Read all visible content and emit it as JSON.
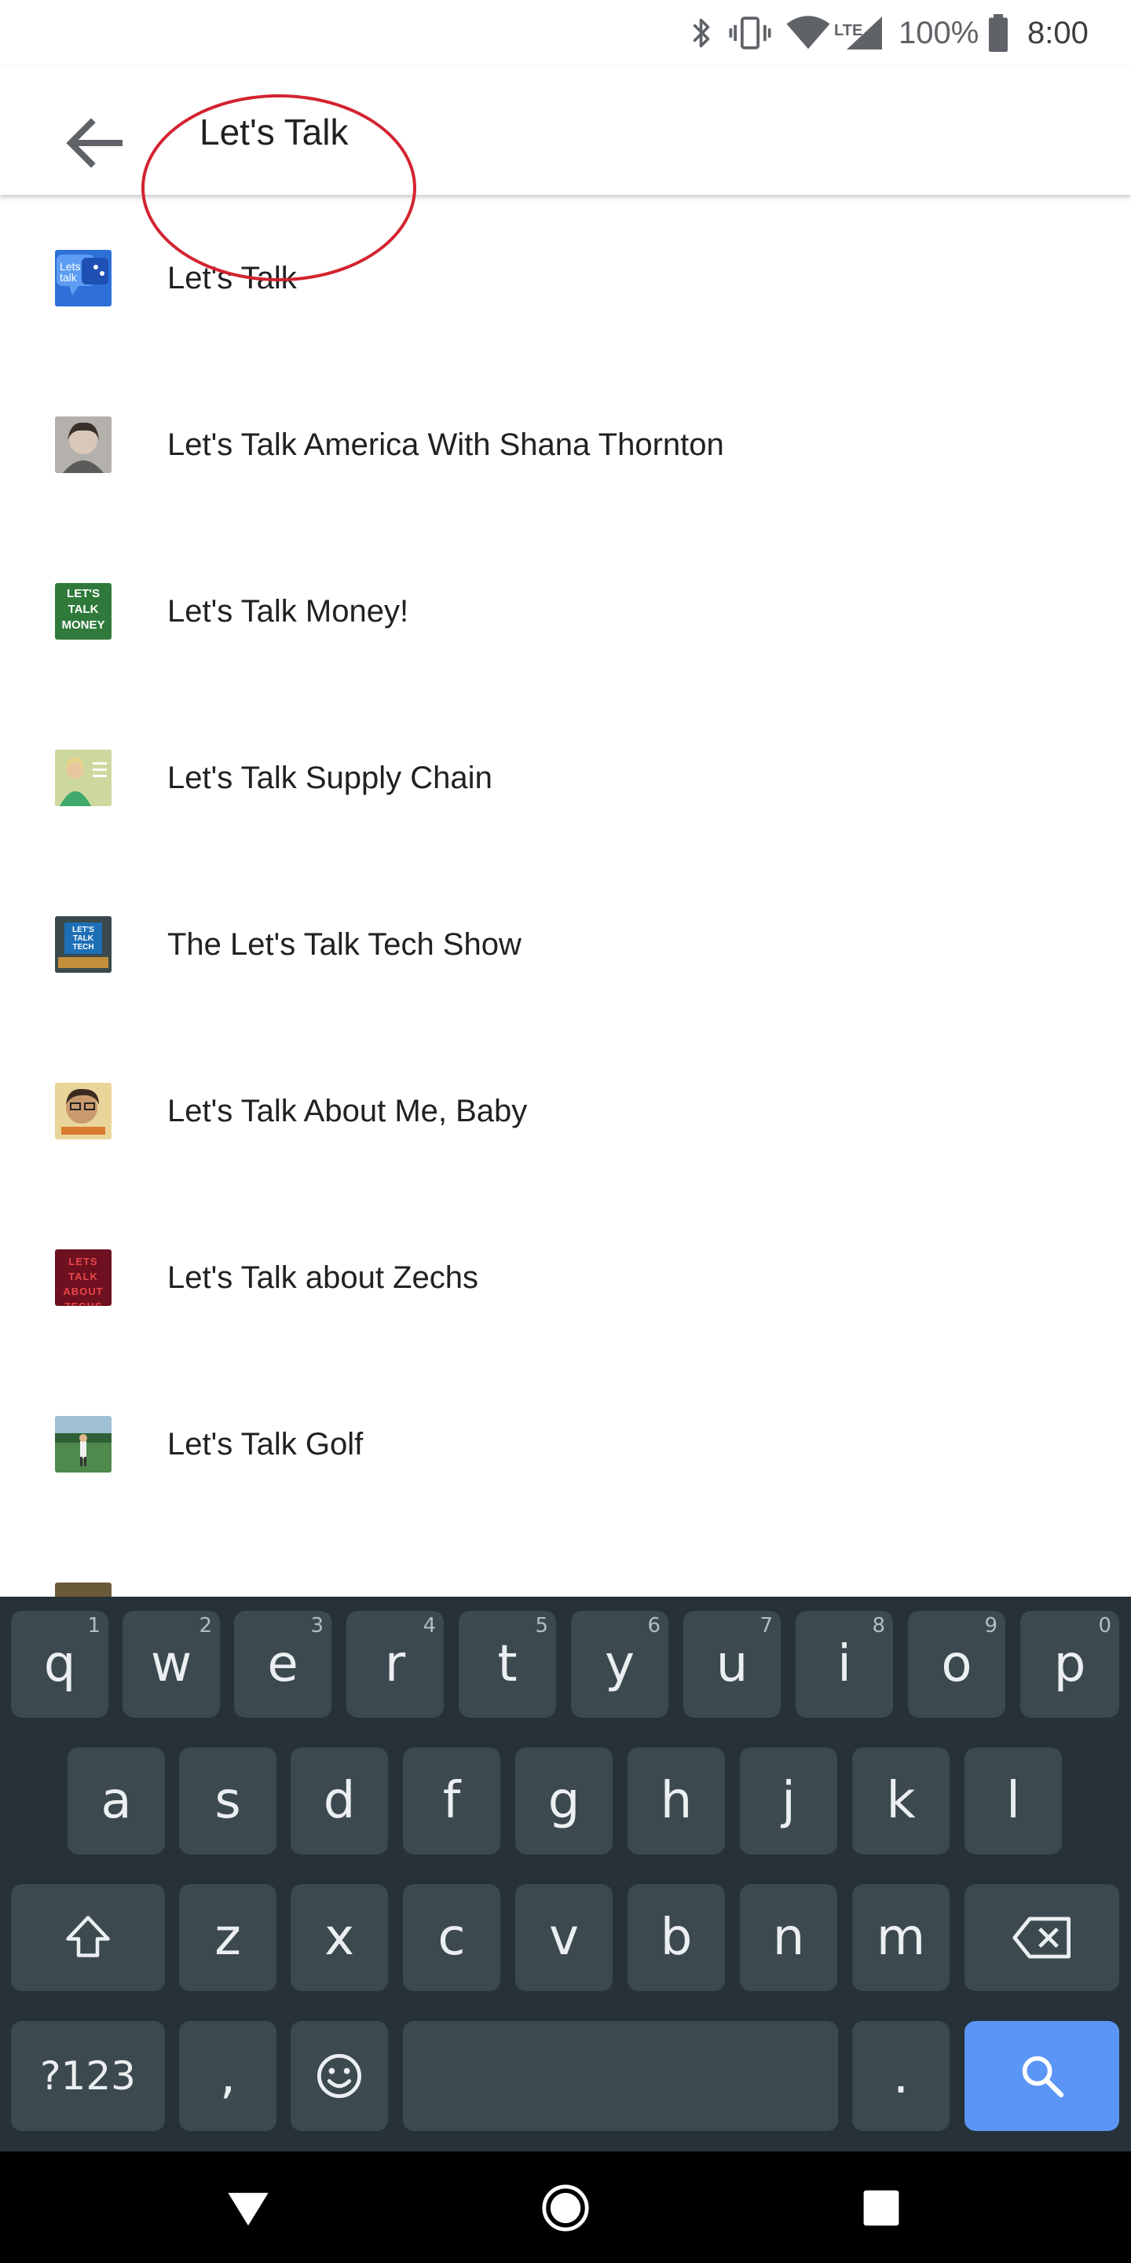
{
  "status_bar": {
    "battery_percent": "100%",
    "time": "8:00",
    "network_label": "LTE",
    "icons": [
      "bluetooth-icon",
      "vibrate-icon",
      "wifi-icon",
      "lte-signal-icon",
      "battery-icon"
    ]
  },
  "search": {
    "query": "Let's Talk",
    "back_icon": "arrow-back-icon"
  },
  "results": [
    {
      "title": "Let's Talk",
      "thumb_text": "Lets talk",
      "icon": "podcast-thumbnail"
    },
    {
      "title": "Let's Talk America With Shana Thornton",
      "thumb_text": "",
      "icon": "podcast-thumbnail"
    },
    {
      "title": "Let's Talk Money!",
      "thumb_text": "LET'S TALK MONEY",
      "icon": "podcast-thumbnail"
    },
    {
      "title": "Let's Talk Supply Chain",
      "thumb_text": "",
      "icon": "podcast-thumbnail"
    },
    {
      "title": "The Let's Talk Tech Show",
      "thumb_text": "LET'S TALK TECH",
      "icon": "podcast-thumbnail"
    },
    {
      "title": "Let's Talk About Me, Baby",
      "thumb_text": "",
      "icon": "podcast-thumbnail"
    },
    {
      "title": "Let's Talk about Zechs",
      "thumb_text": "LETS TALK ABOUT ZECHS",
      "icon": "podcast-thumbnail"
    },
    {
      "title": "Let's Talk Golf",
      "thumb_text": "",
      "icon": "podcast-thumbnail"
    }
  ],
  "keyboard": {
    "row1": [
      {
        "label": "q",
        "hint": "1"
      },
      {
        "label": "w",
        "hint": "2"
      },
      {
        "label": "e",
        "hint": "3"
      },
      {
        "label": "r",
        "hint": "4"
      },
      {
        "label": "t",
        "hint": "5"
      },
      {
        "label": "y",
        "hint": "6"
      },
      {
        "label": "u",
        "hint": "7"
      },
      {
        "label": "i",
        "hint": "8"
      },
      {
        "label": "o",
        "hint": "9"
      },
      {
        "label": "p",
        "hint": "0"
      }
    ],
    "row2": [
      "a",
      "s",
      "d",
      "f",
      "g",
      "h",
      "j",
      "k",
      "l"
    ],
    "row3": [
      "z",
      "x",
      "c",
      "v",
      "b",
      "n",
      "m"
    ],
    "symbols_label": "?123",
    "comma_label": ",",
    "period_label": ".",
    "shift_icon": "shift-icon",
    "backspace_icon": "backspace-icon",
    "emoji_icon": "emoji-icon",
    "search_icon": "search-icon",
    "colors": {
      "background": "#263238",
      "key": "#3c4a50",
      "action_key": "#5b95f5"
    }
  },
  "nav_bar": {
    "icons": [
      "back-triangle-icon",
      "home-circle-icon",
      "recents-square-icon"
    ]
  },
  "annotation": {
    "type": "red-ellipse",
    "color": "#d3232f",
    "target": "search-query"
  }
}
